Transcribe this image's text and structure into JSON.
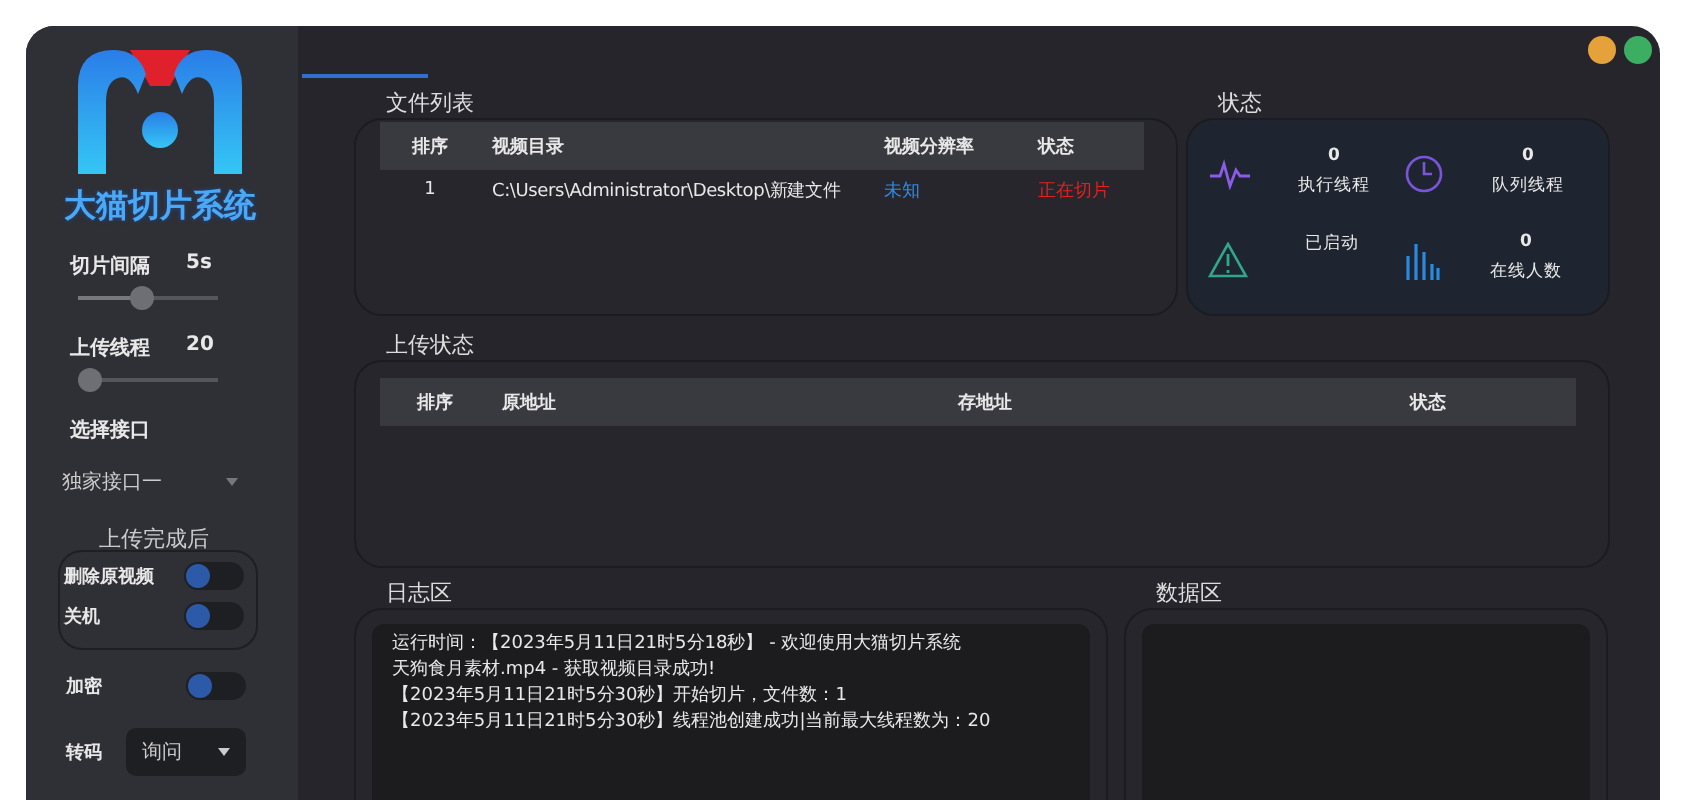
{
  "app": {
    "title": "大猫切片系统"
  },
  "sidebar": {
    "settings": [
      {
        "kind": "slider",
        "label": "切片间隔",
        "value": "5s",
        "level": 0.45
      },
      {
        "kind": "slider",
        "label": "上传线程",
        "value": "20",
        "level": 0.0
      },
      {
        "kind": "select",
        "label": "选择接口",
        "value": "独家接口一"
      }
    ],
    "after_upload": {
      "title": "上传完成后",
      "toggles": [
        {
          "label": "删除原视频",
          "on": false
        },
        {
          "label": "关机",
          "on": false
        }
      ]
    },
    "encrypt": {
      "label": "加密",
      "on": false
    },
    "transcode": {
      "label": "转码",
      "value": "询问"
    }
  },
  "file_list": {
    "title": "文件列表",
    "columns": [
      "排序",
      "视频目录",
      "视频分辨率",
      "状态"
    ],
    "rows": [
      {
        "cells": [
          "1",
          "C:\\Users\\Administrator\\Desktop\\新建文件",
          "未知",
          "正在切片"
        ]
      }
    ]
  },
  "status": {
    "title": "状态",
    "items": [
      {
        "kind": "pulse",
        "value": "0",
        "label": "执行线程"
      },
      {
        "kind": "clock",
        "value": "0",
        "label": "队列线程"
      },
      {
        "kind": "warning",
        "label": "已启动"
      },
      {
        "kind": "bars",
        "value": "0",
        "label": "在线人数"
      }
    ]
  },
  "upload_status": {
    "title": "上传状态",
    "columns": [
      "排序",
      "原地址",
      "存地址",
      "状态"
    ]
  },
  "log": {
    "title": "日志区",
    "lines": [
      "运行时间：【2023年5月11日21时5分18秒】 - 欢迎使用大猫切片系统",
      "天狗食月素材.mp4 - 获取视频目录成功!",
      "【2023年5月11日21时5分30秒】开始切片，文件数：1",
      "【2023年5月11日21时5分30秒】线程池创建成功|当前最大线程数为：20"
    ]
  },
  "data_area": {
    "title": "数据区"
  }
}
